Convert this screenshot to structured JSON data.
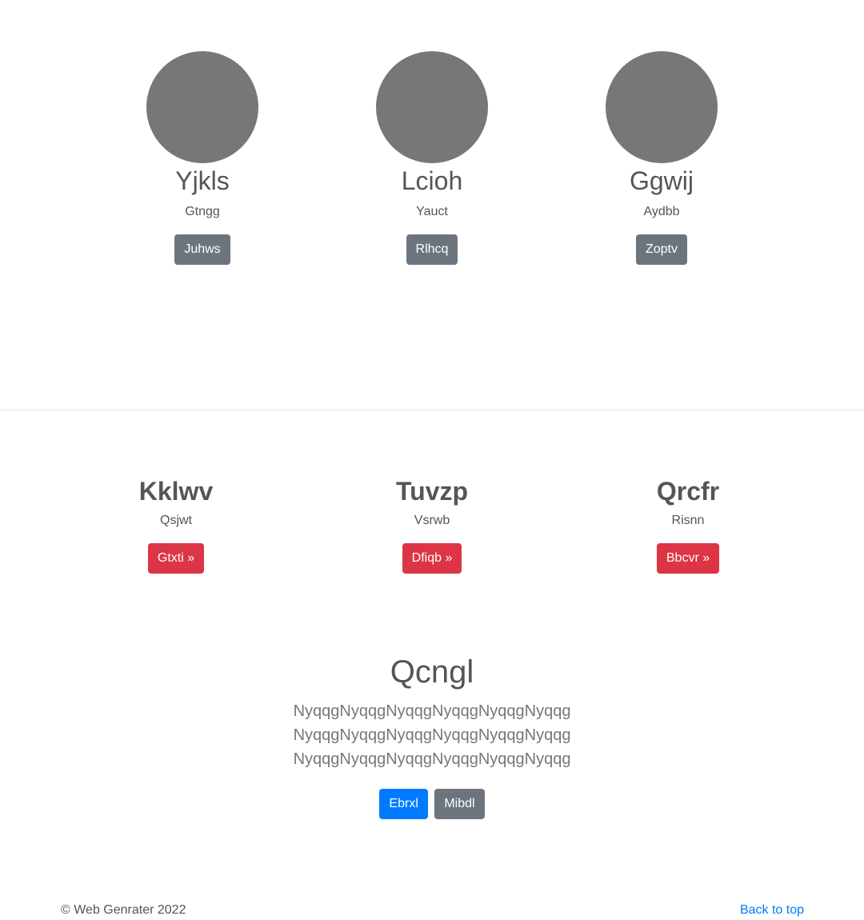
{
  "profiles": [
    {
      "name": "Yjkls",
      "subtitle": "Gtngg",
      "button": "Juhws"
    },
    {
      "name": "Lcioh",
      "subtitle": "Yauct",
      "button": "Rlhcq"
    },
    {
      "name": "Ggwij",
      "subtitle": "Aydbb",
      "button": "Zoptv"
    }
  ],
  "features": [
    {
      "title": "Kklwv",
      "subtitle": "Qsjwt",
      "button": "Gtxti »"
    },
    {
      "title": "Tuvzp",
      "subtitle": "Vsrwb",
      "button": "Dfiqb »"
    },
    {
      "title": "Qrcfr",
      "subtitle": "Risnn",
      "button": "Bbcvr »"
    }
  ],
  "hero": {
    "heading": "Qcngl",
    "lead": "NyqqgNyqqgNyqqgNyqqgNyqqgNyqqg NyqqgNyqqgNyqqgNyqqgNyqqgNyqqg NyqqgNyqqgNyqqgNyqqgNyqqgNyqqg",
    "primary_button": "Ebrxl",
    "secondary_button": "Mibdl"
  },
  "footer": {
    "copyright": "© Web Genrater 2022",
    "back_to_top": "Back to top"
  },
  "colors": {
    "avatar": "#777777",
    "secondary": "#6c757d",
    "danger": "#dc3545",
    "primary": "#007bff",
    "text": "#555555"
  }
}
